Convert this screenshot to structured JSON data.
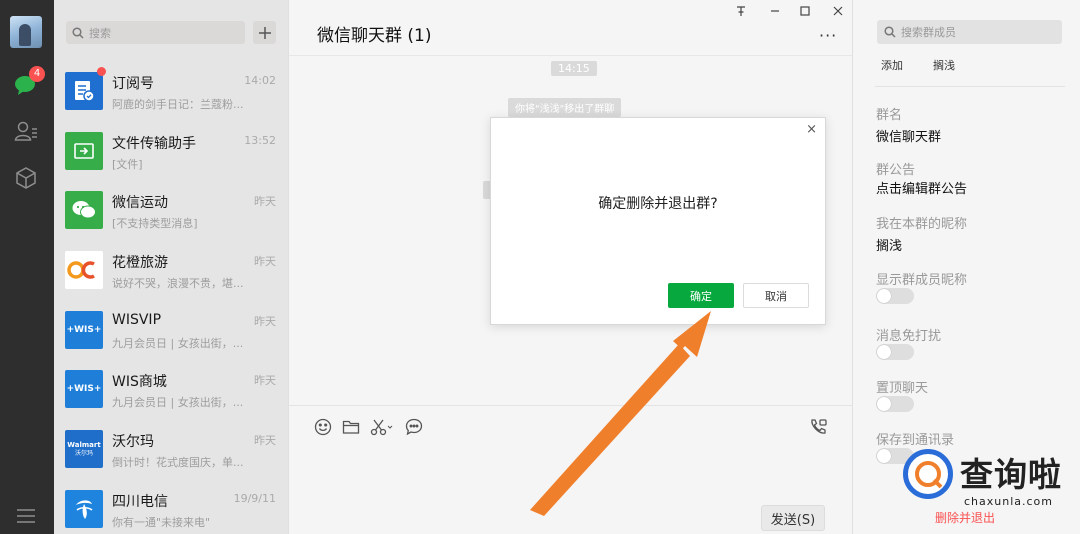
{
  "nav": {
    "chat_badge": "4",
    "icons": [
      "chat-icon",
      "contacts-icon",
      "collections-icon",
      "menu-icon"
    ]
  },
  "sessions": {
    "search_placeholder": "搜索",
    "items": [
      {
        "name": "订阅号",
        "sub": "阿鹿的剑手日记：兰蔻粉...",
        "time": "14:02",
        "color": "#1e6fd0",
        "unread": true
      },
      {
        "name": "文件传输助手",
        "sub": "[文件]",
        "time": "13:52",
        "color": "#36ad48",
        "unread": false
      },
      {
        "name": "微信运动",
        "sub": "[不支持类型消息]",
        "time": "昨天",
        "color": "#36ad48",
        "unread": false
      },
      {
        "name": "花橙旅游",
        "sub": "说好不哭，浪漫不贵，堪...",
        "time": "昨天",
        "color": "#ffffff",
        "unread": false
      },
      {
        "name": "WISVIP",
        "sub": "九月会员日 | 女孩出街，...",
        "time": "昨天",
        "color": "#1f7fd8",
        "unread": false
      },
      {
        "name": "WIS商城",
        "sub": "九月会员日 | 女孩出街，...",
        "time": "昨天",
        "color": "#1f7fd8",
        "unread": false
      },
      {
        "name": "沃尔玛",
        "sub": "倒计时！花式度国庆，单...",
        "time": "昨天",
        "color": "#1f6ec9",
        "unread": false
      },
      {
        "name": "四川电信",
        "sub": "你有一通\"未接来电\"",
        "time": "19/9/11",
        "color": "#1f84de",
        "unread": false
      }
    ],
    "logo_text": {
      "huacheng": "OC",
      "wis": "+WIS+",
      "walmart": "Walmart",
      "walmart_cn": "沃尔玛"
    }
  },
  "chat": {
    "title": "微信聊天群 (1)",
    "more": "···",
    "time_chip": "14:15",
    "system_msg": "你将\"浅浅\"移出了群聊",
    "send_label": "发送(S)"
  },
  "window": {
    "pin": "⊼",
    "minimize": "—",
    "maximize": "□",
    "close": "✕"
  },
  "panel": {
    "search_placeholder": "搜索群成员",
    "add_label": "添加",
    "member_label": "搁浅",
    "group_name_label": "群名",
    "group_name_value": "微信聊天群",
    "notice_label": "群公告",
    "notice_value": "点击编辑群公告",
    "nickname_label": "我在本群的昵称",
    "nickname_value": "搁浅",
    "show_nick_label": "显示群成员昵称",
    "mute_label": "消息免打扰",
    "top_label": "置顶聊天",
    "save_label": "保存到通讯录",
    "delete_exit": "删除并退出"
  },
  "dialog": {
    "message": "确定删除并退出群?",
    "ok_label": "确定",
    "cancel_label": "取消",
    "close": "×"
  },
  "watermark": {
    "brand": "查询啦",
    "domain": "chaxunla.com"
  },
  "colors": {
    "accent_green": "#07a93e",
    "rail_bg": "#2e2e2e",
    "arrow": "#f07f2c",
    "badge_red": "#fa5151",
    "watermark_blue": "#2a6dd9"
  }
}
